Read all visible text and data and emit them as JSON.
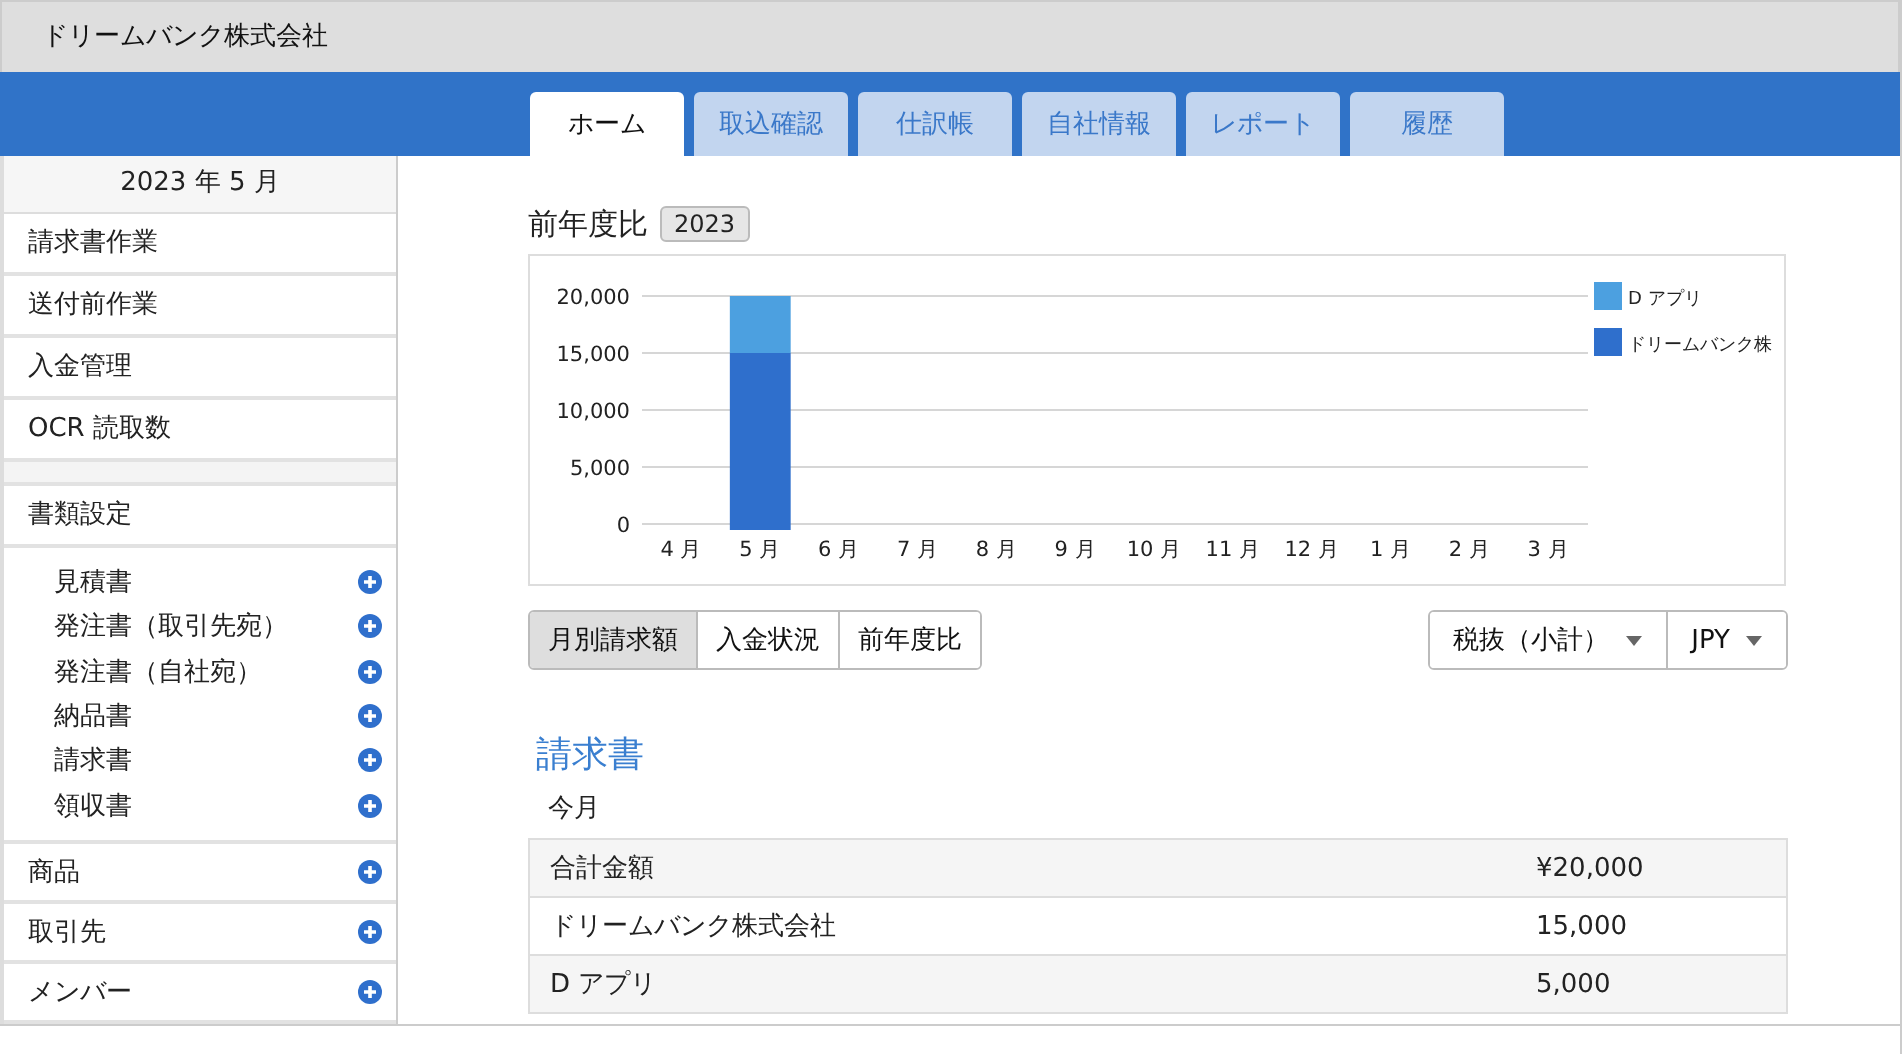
{
  "window": {
    "title": "ドリームバンク株式会社"
  },
  "tabs": [
    {
      "label": "ホーム",
      "selected": true
    },
    {
      "label": "取込確認",
      "selected": false
    },
    {
      "label": "仕訳帳",
      "selected": false
    },
    {
      "label": "自社情報",
      "selected": false
    },
    {
      "label": "レポート",
      "selected": false
    },
    {
      "label": "履歴",
      "selected": false
    }
  ],
  "sidebar": {
    "month": "2023 年 5 月",
    "items": [
      {
        "label": "請求書作業"
      },
      {
        "label": "送付前作業"
      },
      {
        "label": "入金管理"
      },
      {
        "label": "OCR 読取数"
      }
    ],
    "documents_header": "書類設定",
    "documents": [
      {
        "label": "見積書"
      },
      {
        "label": "発注書（取引先宛）"
      },
      {
        "label": "発注書（自社宛）"
      },
      {
        "label": "納品書"
      },
      {
        "label": "請求書"
      },
      {
        "label": "領収書"
      }
    ],
    "lists": [
      {
        "label": "商品"
      },
      {
        "label": "取引先"
      },
      {
        "label": "メンバー"
      }
    ]
  },
  "comparison": {
    "title": "前年度比",
    "year": "2023",
    "chart_data": {
      "type": "bar",
      "stacked": true,
      "grid": true,
      "legend": true,
      "categories": [
        "4 月",
        "5 月",
        "6 月",
        "7 月",
        "8 月",
        "9 月",
        "10 月",
        "11 月",
        "12 月",
        "1 月",
        "2 月",
        "3 月"
      ],
      "series": [
        {
          "name": "ドリームバンク株",
          "color": "#2f6fcc",
          "values": [
            0,
            15000,
            0,
            0,
            0,
            0,
            0,
            0,
            0,
            0,
            0,
            0
          ]
        },
        {
          "name": "D アプリ",
          "color": "#4ca0e0",
          "values": [
            0,
            5000,
            0,
            0,
            0,
            0,
            0,
            0,
            0,
            0,
            0,
            0
          ]
        }
      ],
      "ylim": [
        0,
        20000
      ],
      "yticks": [
        {
          "value": 0,
          "label": "0"
        },
        {
          "value": 5000,
          "label": "5,000"
        },
        {
          "value": 10000,
          "label": "10,000"
        },
        {
          "value": 15000,
          "label": "15,000"
        },
        {
          "value": 20000,
          "label": "20,000"
        }
      ]
    }
  },
  "view_buttons": [
    {
      "label": "月別請求額",
      "selected": true
    },
    {
      "label": "入金状況",
      "selected": false
    },
    {
      "label": "前年度比",
      "selected": false
    }
  ],
  "dropdowns": [
    {
      "value": "税抜（小計）"
    },
    {
      "value": "JPY"
    }
  ],
  "invoice": {
    "title": "請求書",
    "period": "今月",
    "rows": [
      {
        "label": "合計金額",
        "amount": "¥20,000"
      },
      {
        "label": "ドリームバンク株式会社",
        "amount": "15,000"
      },
      {
        "label": "D アプリ",
        "amount": "5,000"
      }
    ]
  }
}
